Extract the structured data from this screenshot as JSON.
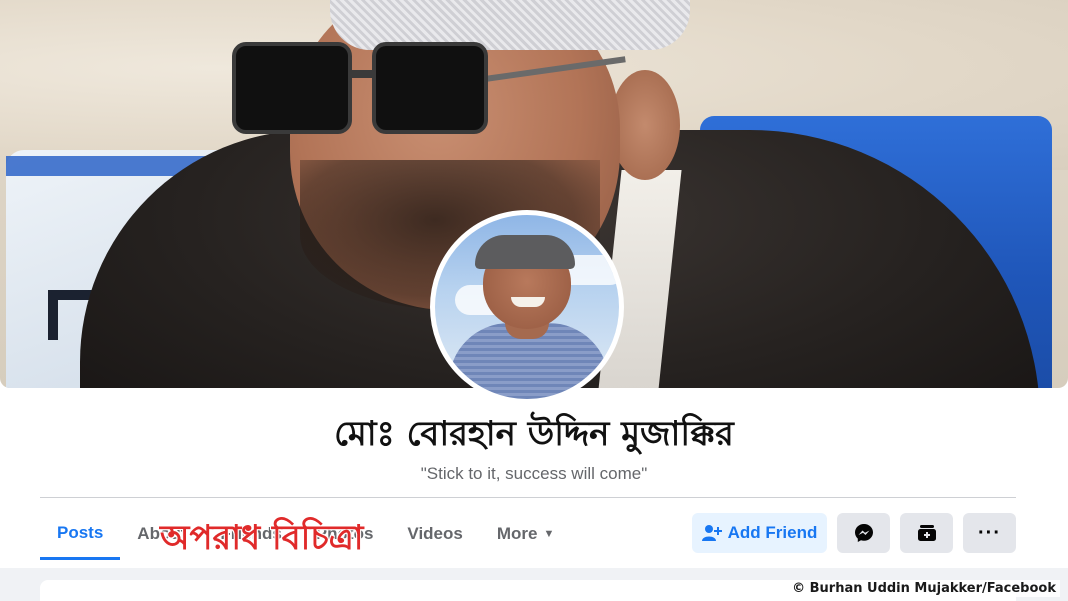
{
  "profile": {
    "name": "মোঃ বোরহান উদ্দিন মুজাক্কির",
    "bio": "\"Stick to it, success will come\""
  },
  "tabs": [
    {
      "label": "Posts",
      "active": true
    },
    {
      "label": "About",
      "active": false
    },
    {
      "label": "Friends",
      "active": false
    },
    {
      "label": "Photos",
      "active": false
    },
    {
      "label": "Videos",
      "active": false
    },
    {
      "label": "More",
      "active": false
    }
  ],
  "actions": {
    "add_friend": "Add Friend",
    "add_friend_icon": "user-plus-icon",
    "messenger_icon": "messenger-icon",
    "stories_icon": "stories-icon",
    "more_icon": "ellipsis-icon"
  },
  "watermark": "অপরাধ বিচিত্রা",
  "credit": "© Burhan Uddin Mujakker/Facebook",
  "colors": {
    "accent": "#1877f2",
    "add_friend_bg": "#e7f3ff",
    "button_bg": "#e4e6eb",
    "watermark": "#e02a2a"
  }
}
